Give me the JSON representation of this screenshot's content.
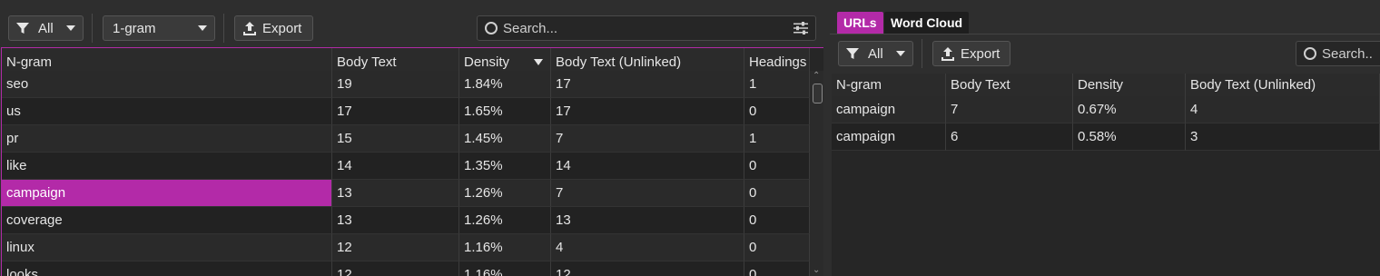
{
  "left": {
    "toolbar": {
      "filter_label": "All",
      "ngram_select": "1-gram",
      "export_label": "Export",
      "search_placeholder": "Search..."
    },
    "columns": [
      "N-gram",
      "Body Text",
      "Density",
      "Body Text (Unlinked)",
      "Headings"
    ],
    "sort_column": "Density",
    "rows": [
      [
        "seo",
        "19",
        "1.84%",
        "17",
        "1"
      ],
      [
        "us",
        "17",
        "1.65%",
        "17",
        "0"
      ],
      [
        "pr",
        "15",
        "1.45%",
        "7",
        "1"
      ],
      [
        "like",
        "14",
        "1.35%",
        "14",
        "0"
      ],
      [
        "campaign",
        "13",
        "1.26%",
        "7",
        "0"
      ],
      [
        "coverage",
        "13",
        "1.26%",
        "13",
        "0"
      ],
      [
        "linux",
        "12",
        "1.16%",
        "4",
        "0"
      ],
      [
        "looks",
        "12",
        "1.16%",
        "12",
        "0"
      ]
    ],
    "selected_row": 4
  },
  "right": {
    "tabs": [
      "URLs",
      "Word Cloud"
    ],
    "active_tab": "URLs",
    "toolbar": {
      "filter_label": "All",
      "export_label": "Export",
      "search_placeholder": "Search..."
    },
    "columns": [
      "N-gram",
      "Body Text",
      "Density",
      "Body Text (Unlinked)"
    ],
    "rows": [
      [
        "campaign",
        "7",
        "0.67%",
        "4"
      ],
      [
        "campaign",
        "6",
        "0.58%",
        "3"
      ]
    ]
  },
  "colors": {
    "accent": "#b32aa8",
    "background": "#2e2e2e",
    "row_odd": "#2a2a2a",
    "row_even": "#222222"
  }
}
